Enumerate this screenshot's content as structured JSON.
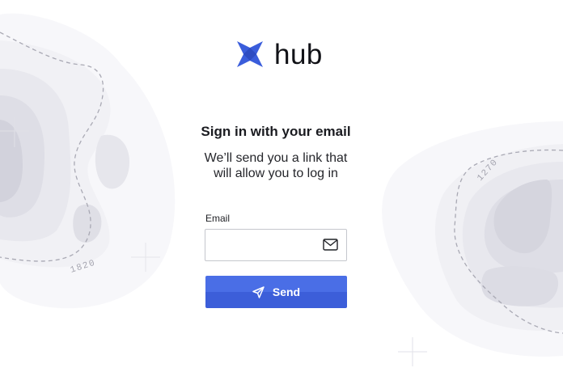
{
  "brand": {
    "name": "hub",
    "accent_color": "#3c5ed9"
  },
  "form": {
    "heading": "Sign in with your email",
    "subtitle_line1": "We’ll send you a link that",
    "subtitle_line2": "will allow you to log in",
    "email_label": "Email",
    "email_value": "",
    "email_icon": "mail-icon",
    "send_label": "Send",
    "send_icon": "send-icon"
  },
  "background": {
    "left_contour_label": "1820",
    "right_contour_label": "1270"
  }
}
